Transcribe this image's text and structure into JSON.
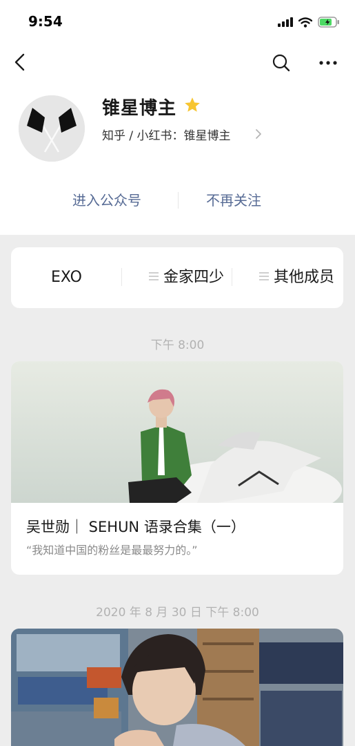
{
  "status_bar": {
    "time": "9:54"
  },
  "profile": {
    "name": "锥星博主",
    "description": "知乎 / 小红书：锥星博主",
    "actions": {
      "enter": "进入公众号",
      "unfollow": "不再关注"
    }
  },
  "menu": {
    "items": [
      "EXO",
      "金家四少",
      "其他成员"
    ]
  },
  "feed": {
    "groups": [
      {
        "timestamp": "下午 8:00",
        "title": "吴世勋｜ SEHUN 语录合集（一）",
        "digest": "“我知道中国的粉丝是最最努力的。”"
      },
      {
        "timestamp": "2020 年 8 月 30 日 下午 8:00"
      }
    ]
  },
  "colors": {
    "link": "#576b95",
    "star": "#f7c531",
    "background": "#ededed"
  }
}
